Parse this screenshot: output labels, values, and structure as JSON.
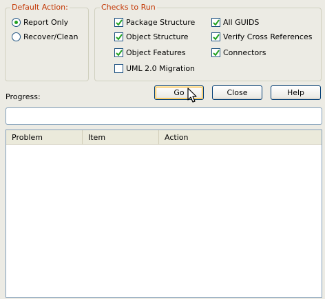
{
  "default_action": {
    "title": "Default Action:",
    "options": [
      {
        "label": "Report Only",
        "selected": true
      },
      {
        "label": "Recover/Clean",
        "selected": false
      }
    ]
  },
  "checks": {
    "title": "Checks to Run",
    "items": [
      {
        "label": "Package Structure",
        "checked": true
      },
      {
        "label": "Object Structure",
        "checked": true
      },
      {
        "label": "Object Features",
        "checked": true
      },
      {
        "label": "UML 2.0 Migration",
        "checked": false
      },
      {
        "label": "All GUIDS",
        "checked": true
      },
      {
        "label": "Verify Cross References",
        "checked": true
      },
      {
        "label": "Connectors",
        "checked": true
      }
    ]
  },
  "buttons": {
    "go": "Go",
    "close": "Close",
    "help": "Help"
  },
  "progress": {
    "label": "Progress:",
    "value": 0
  },
  "results": {
    "columns": [
      "Problem",
      "Item",
      "Action"
    ],
    "rows": []
  },
  "colors": {
    "group_title": "#c23400",
    "check_mark": "#21a121",
    "background": "#ecebe4"
  }
}
